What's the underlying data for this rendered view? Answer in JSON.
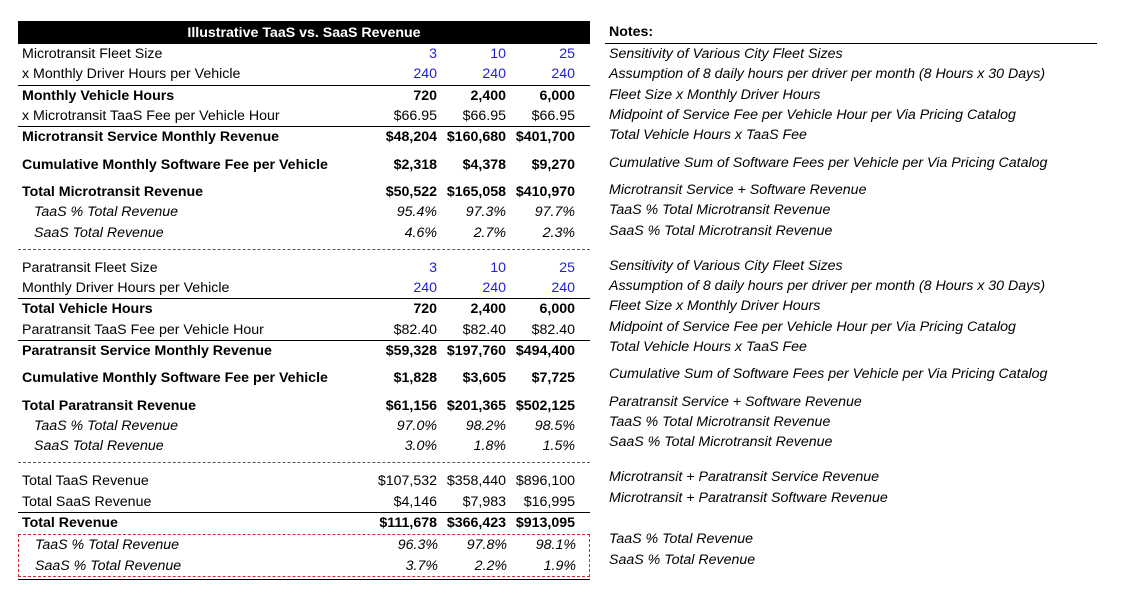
{
  "title": "Illustrative TaaS vs. SaaS Revenue",
  "notes_header": "Notes:",
  "micro": {
    "fleet_size": {
      "label": "Microtransit Fleet Size",
      "v": [
        "3",
        "10",
        "25"
      ]
    },
    "driver_hours": {
      "label": "x Monthly Driver Hours per Vehicle",
      "v": [
        "240",
        "240",
        "240"
      ]
    },
    "vehicle_hours": {
      "label": "Monthly Vehicle Hours",
      "v": [
        "720",
        "2,400",
        "6,000"
      ]
    },
    "taas_fee": {
      "label": "x Microtransit TaaS Fee per Vehicle Hour",
      "v": [
        "$66.95",
        "$66.95",
        "$66.95"
      ]
    },
    "service_rev": {
      "label": "Microtransit Service Monthly Revenue",
      "v": [
        "$48,204",
        "$160,680",
        "$401,700"
      ]
    },
    "software_fee": {
      "label": "Cumulative Monthly Software Fee per Vehicle",
      "v": [
        "$2,318",
        "$4,378",
        "$9,270"
      ]
    },
    "total_rev": {
      "label": "Total Microtransit Revenue",
      "v": [
        "$50,522",
        "$165,058",
        "$410,970"
      ]
    },
    "taas_pct": {
      "label": "TaaS % Total Revenue",
      "v": [
        "95.4%",
        "97.3%",
        "97.7%"
      ]
    },
    "saas_pct": {
      "label": "SaaS Total Revenue",
      "v": [
        "4.6%",
        "2.7%",
        "2.3%"
      ]
    }
  },
  "para": {
    "fleet_size": {
      "label": "Paratransit Fleet Size",
      "v": [
        "3",
        "10",
        "25"
      ]
    },
    "driver_hours": {
      "label": "Monthly Driver Hours per Vehicle",
      "v": [
        "240",
        "240",
        "240"
      ]
    },
    "vehicle_hours": {
      "label": "Total Vehicle Hours",
      "v": [
        "720",
        "2,400",
        "6,000"
      ]
    },
    "taas_fee": {
      "label": "Paratransit TaaS Fee per Vehicle Hour",
      "v": [
        "$82.40",
        "$82.40",
        "$82.40"
      ]
    },
    "service_rev": {
      "label": "Paratransit Service Monthly Revenue",
      "v": [
        "$59,328",
        "$197,760",
        "$494,400"
      ]
    },
    "software_fee": {
      "label": "Cumulative Monthly Software Fee per Vehicle",
      "v": [
        "$1,828",
        "$3,605",
        "$7,725"
      ]
    },
    "total_rev": {
      "label": "Total Paratransit Revenue",
      "v": [
        "$61,156",
        "$201,365",
        "$502,125"
      ]
    },
    "taas_pct": {
      "label": "TaaS % Total Revenue",
      "v": [
        "97.0%",
        "98.2%",
        "98.5%"
      ]
    },
    "saas_pct": {
      "label": "SaaS Total Revenue",
      "v": [
        "3.0%",
        "1.8%",
        "1.5%"
      ]
    }
  },
  "total": {
    "taas_rev": {
      "label": "Total TaaS Revenue",
      "v": [
        "$107,532",
        "$358,440",
        "$896,100"
      ]
    },
    "saas_rev": {
      "label": "Total SaaS Revenue",
      "v": [
        "$4,146",
        "$7,983",
        "$16,995"
      ]
    },
    "total_rev": {
      "label": "Total Revenue",
      "v": [
        "$111,678",
        "$366,423",
        "$913,095"
      ]
    },
    "taas_pct": {
      "label": "TaaS % Total Revenue",
      "v": [
        "96.3%",
        "97.8%",
        "98.1%"
      ]
    },
    "saas_pct": {
      "label": "SaaS % Total Revenue",
      "v": [
        "3.7%",
        "2.2%",
        "1.9%"
      ]
    }
  },
  "notes": {
    "n1": "Sensitivity of Various City Fleet Sizes",
    "n2": "Assumption of 8 daily hours per driver per month (8 Hours x 30 Days)",
    "n3": "Fleet Size x Monthly Driver Hours",
    "n4": "Midpoint of Service Fee per Vehicle Hour per Via Pricing Catalog",
    "n5": "Total Vehicle Hours x TaaS Fee",
    "n6": "Cumulative Sum of Software Fees per Vehicle per Via Pricing Catalog",
    "n7": "Microtransit Service + Software Revenue",
    "n8": "TaaS % Total Microtransit Revenue",
    "n9": "SaaS % Total Microtransit Revenue",
    "p1": "Sensitivity of Various City Fleet Sizes",
    "p2": "Assumption of 8 daily hours per driver per month (8 Hours x 30 Days)",
    "p3": "Fleet Size x Monthly Driver Hours",
    "p4": "Midpoint of Service Fee per Vehicle Hour per Via Pricing Catalog",
    "p5": "Total Vehicle Hours x TaaS Fee",
    "p6": "Cumulative Sum of Software Fees per Vehicle per Via Pricing Catalog",
    "p7": "Paratransit Service + Software Revenue",
    "p8": "TaaS % Total Microtransit Revenue",
    "p9": "SaaS % Total Microtransit Revenue",
    "t1": "Microtransit + Paratransit Service Revenue",
    "t2": "Microtransit + Paratransit Software Revenue",
    "t3": "TaaS % Total Revenue",
    "t4": "SaaS % Total Revenue"
  }
}
